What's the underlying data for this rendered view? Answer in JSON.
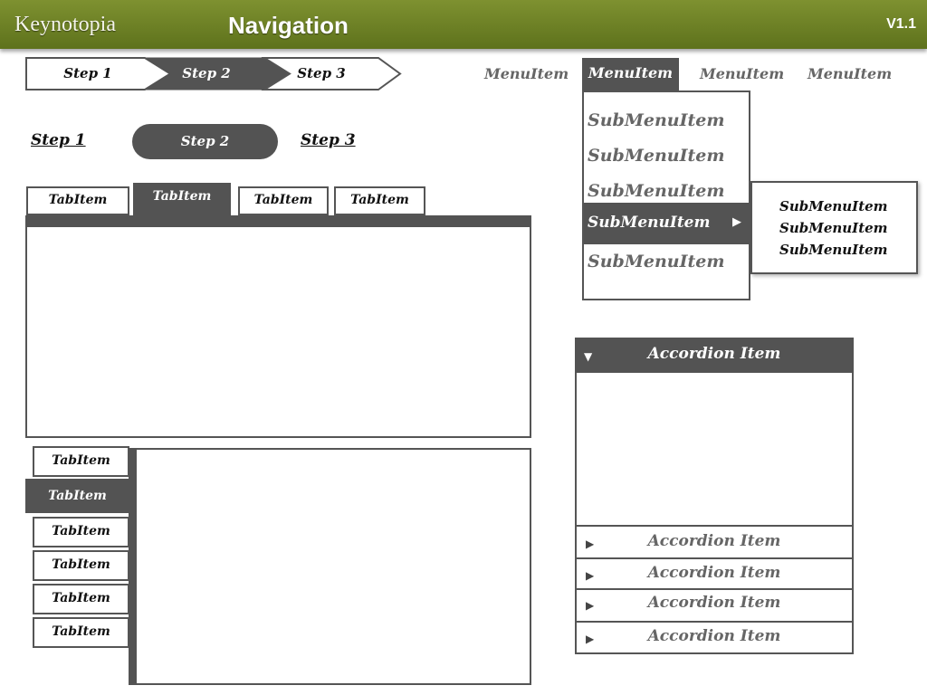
{
  "header": {
    "brand": "Keynotopia",
    "title": "Navigation",
    "version": "V1.1"
  },
  "breadcrumb": {
    "steps": [
      "Step 1",
      "Step 2",
      "Step 3"
    ],
    "active_index": 1
  },
  "pill_steps": {
    "steps": [
      "Step 1",
      "Step 2",
      "Step 3"
    ],
    "active_index": 1
  },
  "horizontal_tabs": {
    "tabs": [
      "TabItem",
      "TabItem",
      "TabItem",
      "TabItem"
    ],
    "active_index": 1
  },
  "vertical_tabs": {
    "tabs": [
      "TabItem",
      "TabItem",
      "TabItem",
      "TabItem",
      "TabItem",
      "TabItem"
    ],
    "active_index": 1
  },
  "menubar": {
    "items": [
      "MenuItem",
      "MenuItem",
      "MenuItem",
      "MenuItem"
    ],
    "active_index": 1,
    "submenu": [
      "SubMenuItem",
      "SubMenuItem",
      "SubMenuItem",
      "SubMenuItem",
      "SubMenuItem"
    ],
    "submenu_active_index": 3,
    "flyout": [
      "SubMenuItem",
      "SubMenuItem",
      "SubMenuItem"
    ]
  },
  "accordion": {
    "items": [
      "Accordion Item",
      "Accordion Item",
      "Accordion Item",
      "Accordion Item",
      "Accordion Item"
    ],
    "expanded_index": 0
  },
  "icons": {
    "expanded": "triangle-down-icon",
    "collapsed": "triangle-right-icon",
    "submenu_arrow": "triangle-right-icon"
  },
  "colors": {
    "header_top": "#7e9130",
    "header_bottom": "#5e721c",
    "active_fill": "#535353",
    "border": "#555555",
    "inactive_text": "#666666"
  }
}
